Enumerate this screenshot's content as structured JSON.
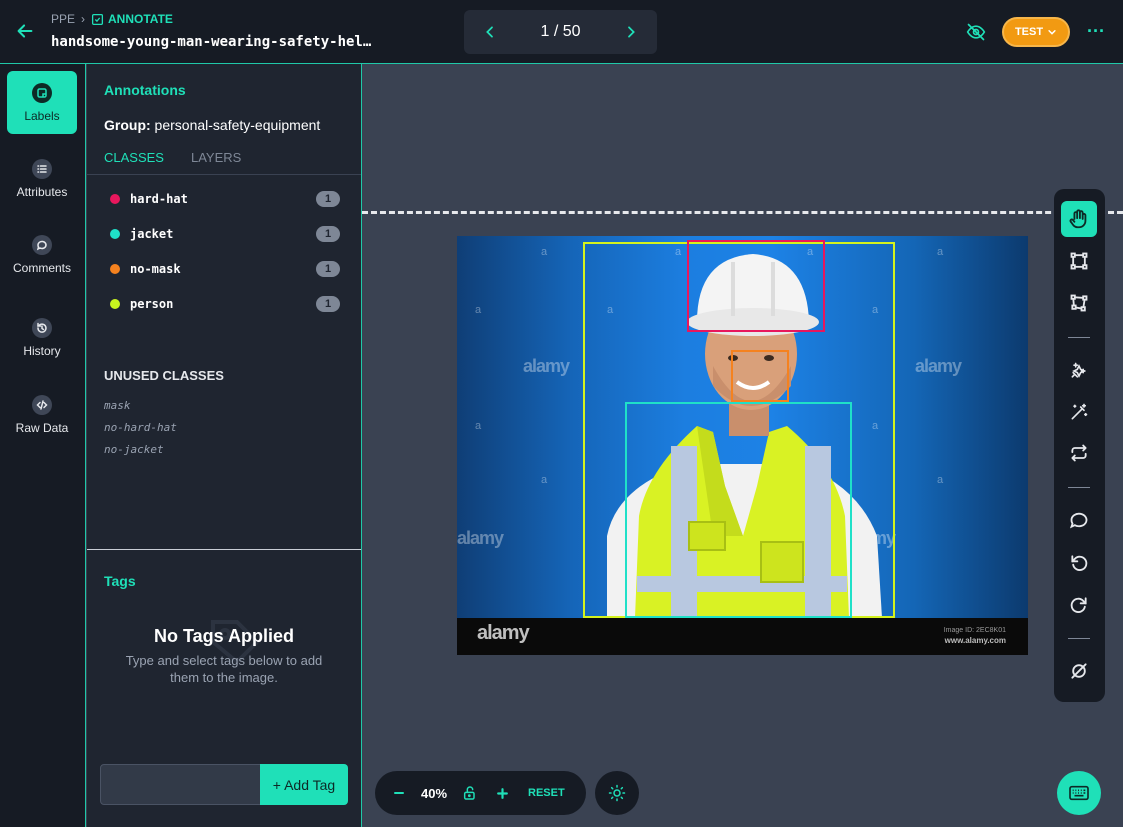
{
  "header": {
    "breadcrumb_root": "PPE",
    "breadcrumb_current": "ANNOTATE",
    "filename": "handsome-young-man-wearing-safety-hel…",
    "pager": "1 / 50",
    "test_label": "TEST",
    "accent_color": "#1fe0b8",
    "test_color": "#f29a12"
  },
  "rail": {
    "items": [
      {
        "label": "Labels",
        "icon": "label-icon"
      },
      {
        "label": "Attributes",
        "icon": "list-icon"
      },
      {
        "label": "Comments",
        "icon": "comment-icon"
      },
      {
        "label": "History",
        "icon": "history-icon"
      },
      {
        "label": "Raw Data",
        "icon": "code-icon"
      }
    ]
  },
  "panel": {
    "title": "Annotations",
    "group_label": "Group:",
    "group_value": "personal-safety-equipment",
    "tabs": [
      "CLASSES",
      "LAYERS"
    ],
    "classes": [
      {
        "name": "hard-hat",
        "count": "1",
        "color": "#e8175d"
      },
      {
        "name": "jacket",
        "count": "1",
        "color": "#1fe0c8"
      },
      {
        "name": "no-mask",
        "count": "1",
        "color": "#f5821f"
      },
      {
        "name": "person",
        "count": "1",
        "color": "#c8f51f"
      }
    ],
    "unused_title": "UNUSED CLASSES",
    "unused": [
      "mask",
      "no-hard-hat",
      "no-jacket"
    ]
  },
  "tags": {
    "title": "Tags",
    "empty_title": "No Tags Applied",
    "empty_sub": "Type and select tags below to add them to the image.",
    "input_value": "",
    "add_label": "+ Add Tag"
  },
  "image": {
    "watermark": "alamy",
    "watermark_small": "a",
    "footer_brand": "alamy",
    "footer_id": "Image ID: 2EC8K01",
    "footer_url": "www.alamy.com"
  },
  "zoom": {
    "value": "40%",
    "reset_label": "RESET"
  }
}
